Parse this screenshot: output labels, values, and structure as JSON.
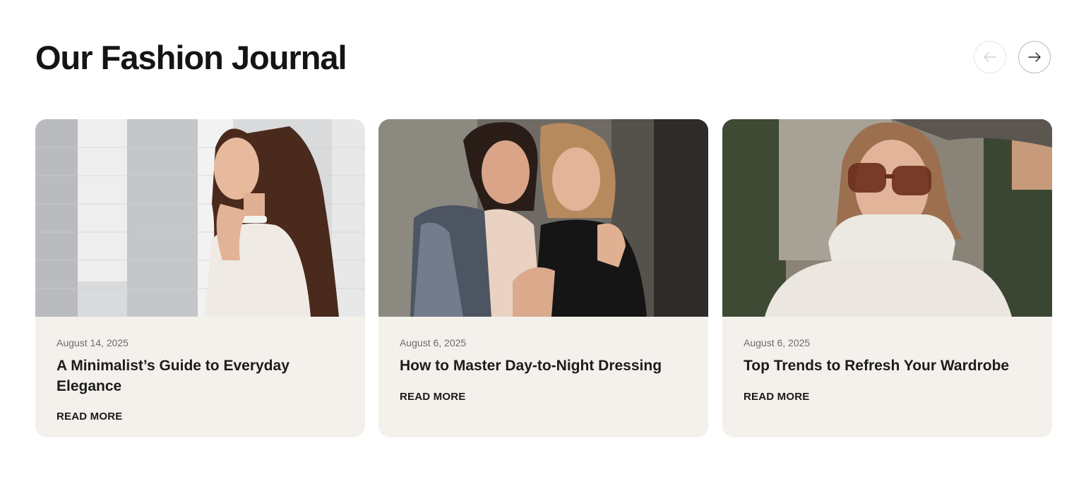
{
  "section": {
    "title": "Our Fashion Journal"
  },
  "navigation": {
    "prev_icon": "arrow-left-icon",
    "next_icon": "arrow-right-icon",
    "prev_disabled": true
  },
  "posts": [
    {
      "date": "August 14, 2025",
      "title": "A Minimalist’s Guide to Everyday Elegance",
      "link_label": "READ MORE",
      "image": "woman-white-dress-photo"
    },
    {
      "date": "August 6, 2025",
      "title": "How to Master Day-to-Night Dressing",
      "link_label": "READ MORE",
      "image": "two-women-evening-photo"
    },
    {
      "date": "August 6, 2025",
      "title": "Top Trends to Refresh Your Wardrobe",
      "link_label": "READ MORE",
      "image": "woman-sunglasses-turtleneck-photo"
    }
  ],
  "colors": {
    "card_background": "#f4f1ec",
    "heading": "#151515",
    "date_text": "#6b6b6b"
  }
}
